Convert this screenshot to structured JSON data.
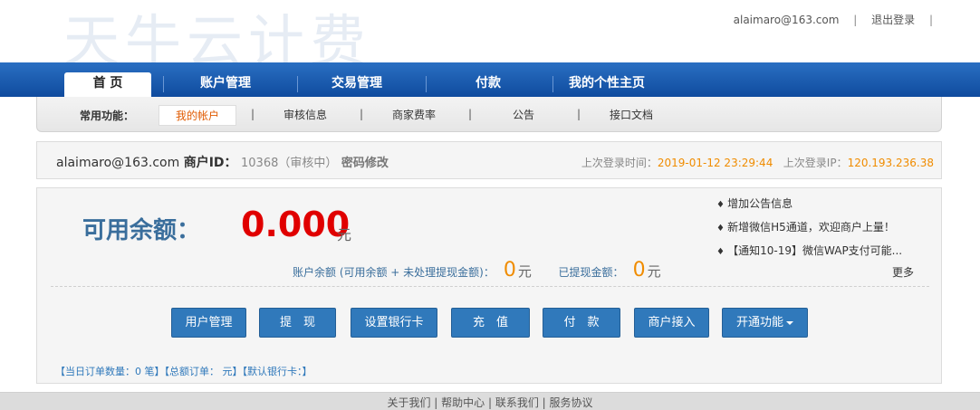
{
  "header": {
    "logo": "天牛云计费",
    "user_email": "alaimaro@163.com",
    "sep1": "|",
    "logout": "退出登录",
    "sep2": "|"
  },
  "nav": {
    "items": [
      {
        "label": "首 页"
      },
      {
        "label": "账户管理"
      },
      {
        "label": "交易管理"
      },
      {
        "label": "付款"
      },
      {
        "label": "我的个性主页"
      }
    ]
  },
  "subnav": {
    "label": "常用功能：",
    "items": [
      {
        "label": "我的帐户"
      },
      {
        "label": "审核信息"
      },
      {
        "label": "商家费率"
      },
      {
        "label": "公告"
      },
      {
        "label": "接口文档"
      }
    ],
    "sep": "|"
  },
  "info": {
    "email": "alaimaro@163.com",
    "merchant_id_label": "商户ID：",
    "merchant_id": "10368（审核中）",
    "password_link": "密码修改",
    "last_login_time_label": "上次登录时间：",
    "last_login_time": "2019-01-12 23:29:44",
    "last_login_ip_label": "上次登录IP：",
    "last_login_ip": "120.193.236.38"
  },
  "balance": {
    "label": "可用余额：",
    "value": "0.000",
    "unit": "元",
    "account_label": "账户余额 (可用余额 + 未处理提现金额)：",
    "account_value": "0",
    "account_unit": "元",
    "withdrawn_label": "已提现金额：",
    "withdrawn_value": "0",
    "withdrawn_unit": "元"
  },
  "notices": {
    "items": [
      {
        "text": "增加公告信息"
      },
      {
        "text": "新增微信H5通道，欢迎商户上量！"
      },
      {
        "text": "【通知10-19】微信WAP支付可能..."
      }
    ],
    "more": "更多"
  },
  "buttons": [
    {
      "label": "用户管理"
    },
    {
      "label": "提　现"
    },
    {
      "label": "设置银行卡"
    },
    {
      "label": "充　值"
    },
    {
      "label": "付　款"
    },
    {
      "label": "商户接入"
    },
    {
      "label": "开通功能"
    }
  ],
  "stats": {
    "text": "【当日订单数量：0 笔】【总额订单： 元】【默认银行卡：】"
  },
  "footer": {
    "links": [
      "关于我们",
      "帮助中心",
      "联系我们",
      "服务协议"
    ],
    "sep": " | "
  }
}
